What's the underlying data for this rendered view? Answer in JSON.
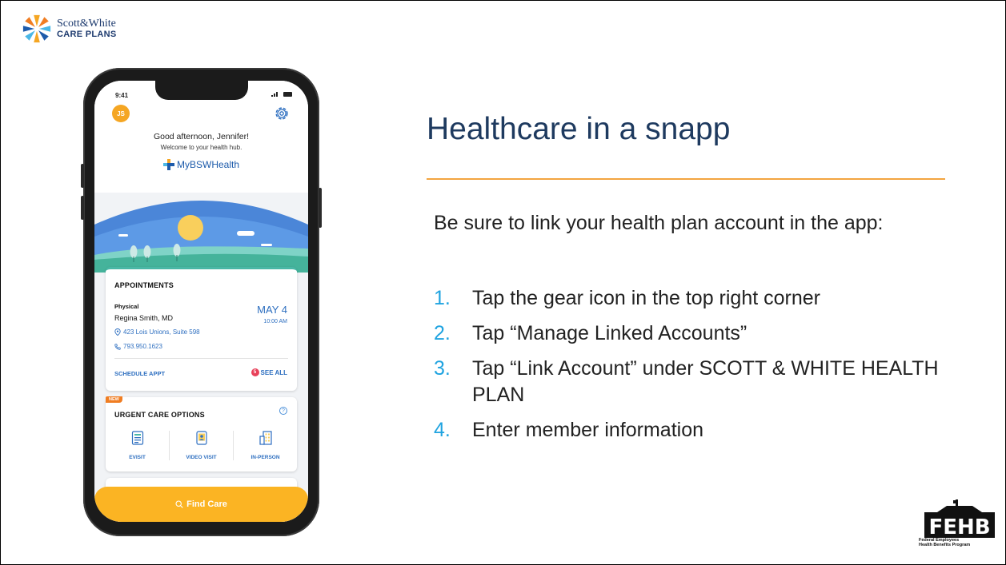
{
  "brand": {
    "logo_line1": "Scott&White",
    "logo_line2": "CARE PLANS"
  },
  "phone": {
    "status_time": "9:41",
    "avatar_initials": "JS",
    "greeting": "Good afternoon, Jennifer!",
    "greeting_sub": "Welcome to your health hub.",
    "app_name": "MyBSWHealth",
    "appointments": {
      "title": "APPOINTMENTS",
      "type": "Physical",
      "doctor": "Regina Smith, MD",
      "address": "423 Lois Unions, Suite 598",
      "phone": "793.950.1623",
      "date": "MAY 4",
      "time": "10:00 AM",
      "schedule_label": "SCHEDULE APPT",
      "see_all_label": "SEE ALL",
      "badge_count": "5"
    },
    "urgent_care": {
      "new_tag": "NEW",
      "title": "URGENT CARE OPTIONS",
      "options": [
        {
          "label": "EVISIT",
          "icon": "checklist-icon"
        },
        {
          "label": "VIDEO VISIT",
          "icon": "video-visit-icon"
        },
        {
          "label": "IN-PERSON",
          "icon": "building-icon"
        }
      ]
    },
    "find_care_label": "Find Care"
  },
  "slide": {
    "heading": "Healthcare in a snapp",
    "intro": "Be sure to link your health plan account in the app:",
    "steps": [
      {
        "num": "1.",
        "text": "Tap the gear icon in the top right corner"
      },
      {
        "num": "2.",
        "text": "Tap “Manage Linked Accounts”"
      },
      {
        "num": "3.",
        "text": "Tap “Link Account” under SCOTT & WHITE HEALTH PLAN"
      },
      {
        "num": "4.",
        "text": "Enter member information"
      }
    ]
  },
  "fehb": {
    "letters": "FEHB",
    "caption_line1": "Federal Employees",
    "caption_line2": "Health Benefits Program"
  },
  "colors": {
    "accent_orange": "#f3a540",
    "step_number_blue": "#1fa3e0",
    "heading_navy": "#1e3a5f",
    "app_link_blue": "#2e6fc0",
    "find_care_yellow": "#fbb423"
  }
}
